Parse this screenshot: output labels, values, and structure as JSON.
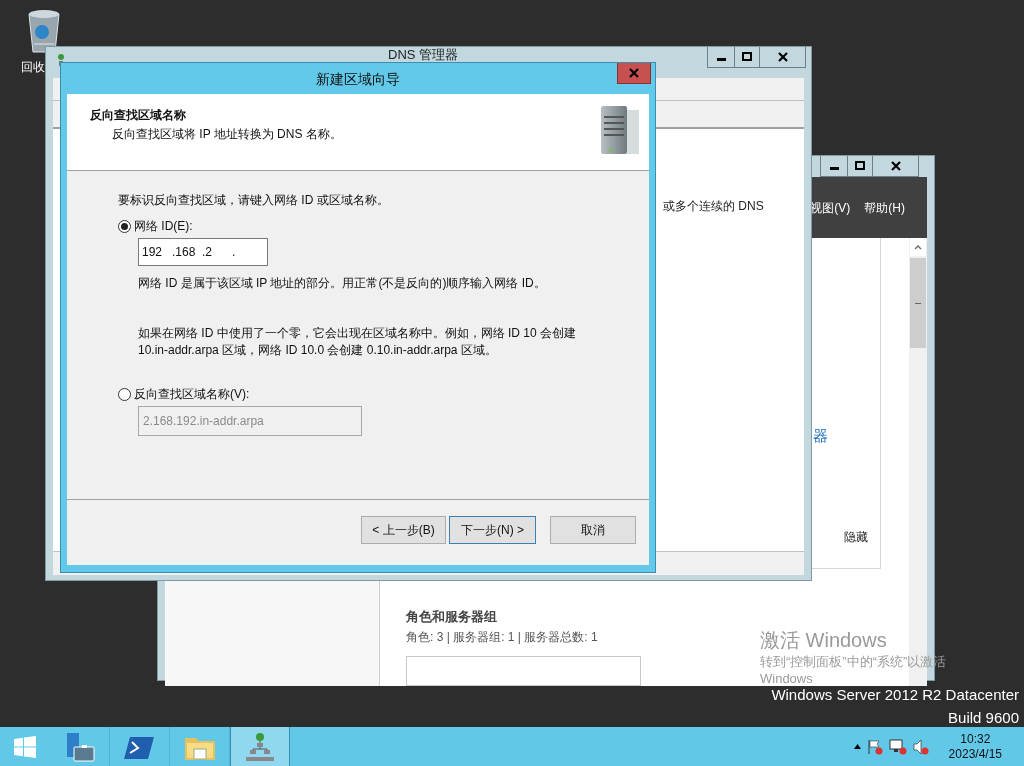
{
  "desktop": {
    "icons": [
      {
        "label": "回收"
      }
    ],
    "activation": {
      "title": "激活 Windows",
      "line1": "转到“控制面板”中的“系统”以激活",
      "line2": "Windows"
    },
    "os_info": [
      "Windows Server 2012 R2 Datacenter",
      "Build 9600"
    ]
  },
  "server_manager": {
    "menu": [
      "视图(V)",
      "帮助(H)"
    ],
    "link": "器",
    "hide_label": "隐藏",
    "section_title": "角色和服务器组",
    "section_summary": "角色: 3 | 服务器组: 1 | 服务器总数: 1"
  },
  "dns_manager": {
    "title": "DNS 管理器",
    "content_text": "或多个连续的 DNS"
  },
  "wizard": {
    "title": "新建区域向导",
    "header_title": "反向查找区域名称",
    "header_subtitle": "反向查找区域将 IP 地址转换为 DNS 名称。",
    "instruction": "要标识反向查找区域，请键入网络 ID 或区域名称。",
    "options": [
      {
        "label": "网络 ID(E):",
        "selected": true
      },
      {
        "label": "反向查找区域名称(V):",
        "selected": false
      }
    ],
    "network_id": [
      "192",
      ".168",
      ".2",
      "."
    ],
    "network_id_note": "网络 ID 是属于该区域 IP 地址的部分。用正常(不是反向的)顺序输入网络 ID。",
    "zero_note": [
      "如果在网络 ID 中使用了一个零，它会出现在区域名称中。例如，网络 ID 10 会创建",
      "10.in-addr.arpa 区域，网络 ID 10.0 会创建 0.10.in-addr.arpa 区域。"
    ],
    "zone_name_value": "2.168.192.in-addr.arpa",
    "buttons": [
      {
        "label": "< 上一步(B)",
        "default": false
      },
      {
        "label": "下一步(N) >",
        "default": true
      },
      {
        "label": "取消",
        "default": false
      }
    ]
  },
  "taskbar": {
    "apps": [
      {
        "kind": "server-manager",
        "active": false
      },
      {
        "kind": "powershell",
        "active": false
      },
      {
        "kind": "explorer",
        "active": false
      },
      {
        "kind": "dns",
        "active": true
      }
    ],
    "clock": {
      "time": "10:32",
      "date": "2023/4/15"
    }
  }
}
